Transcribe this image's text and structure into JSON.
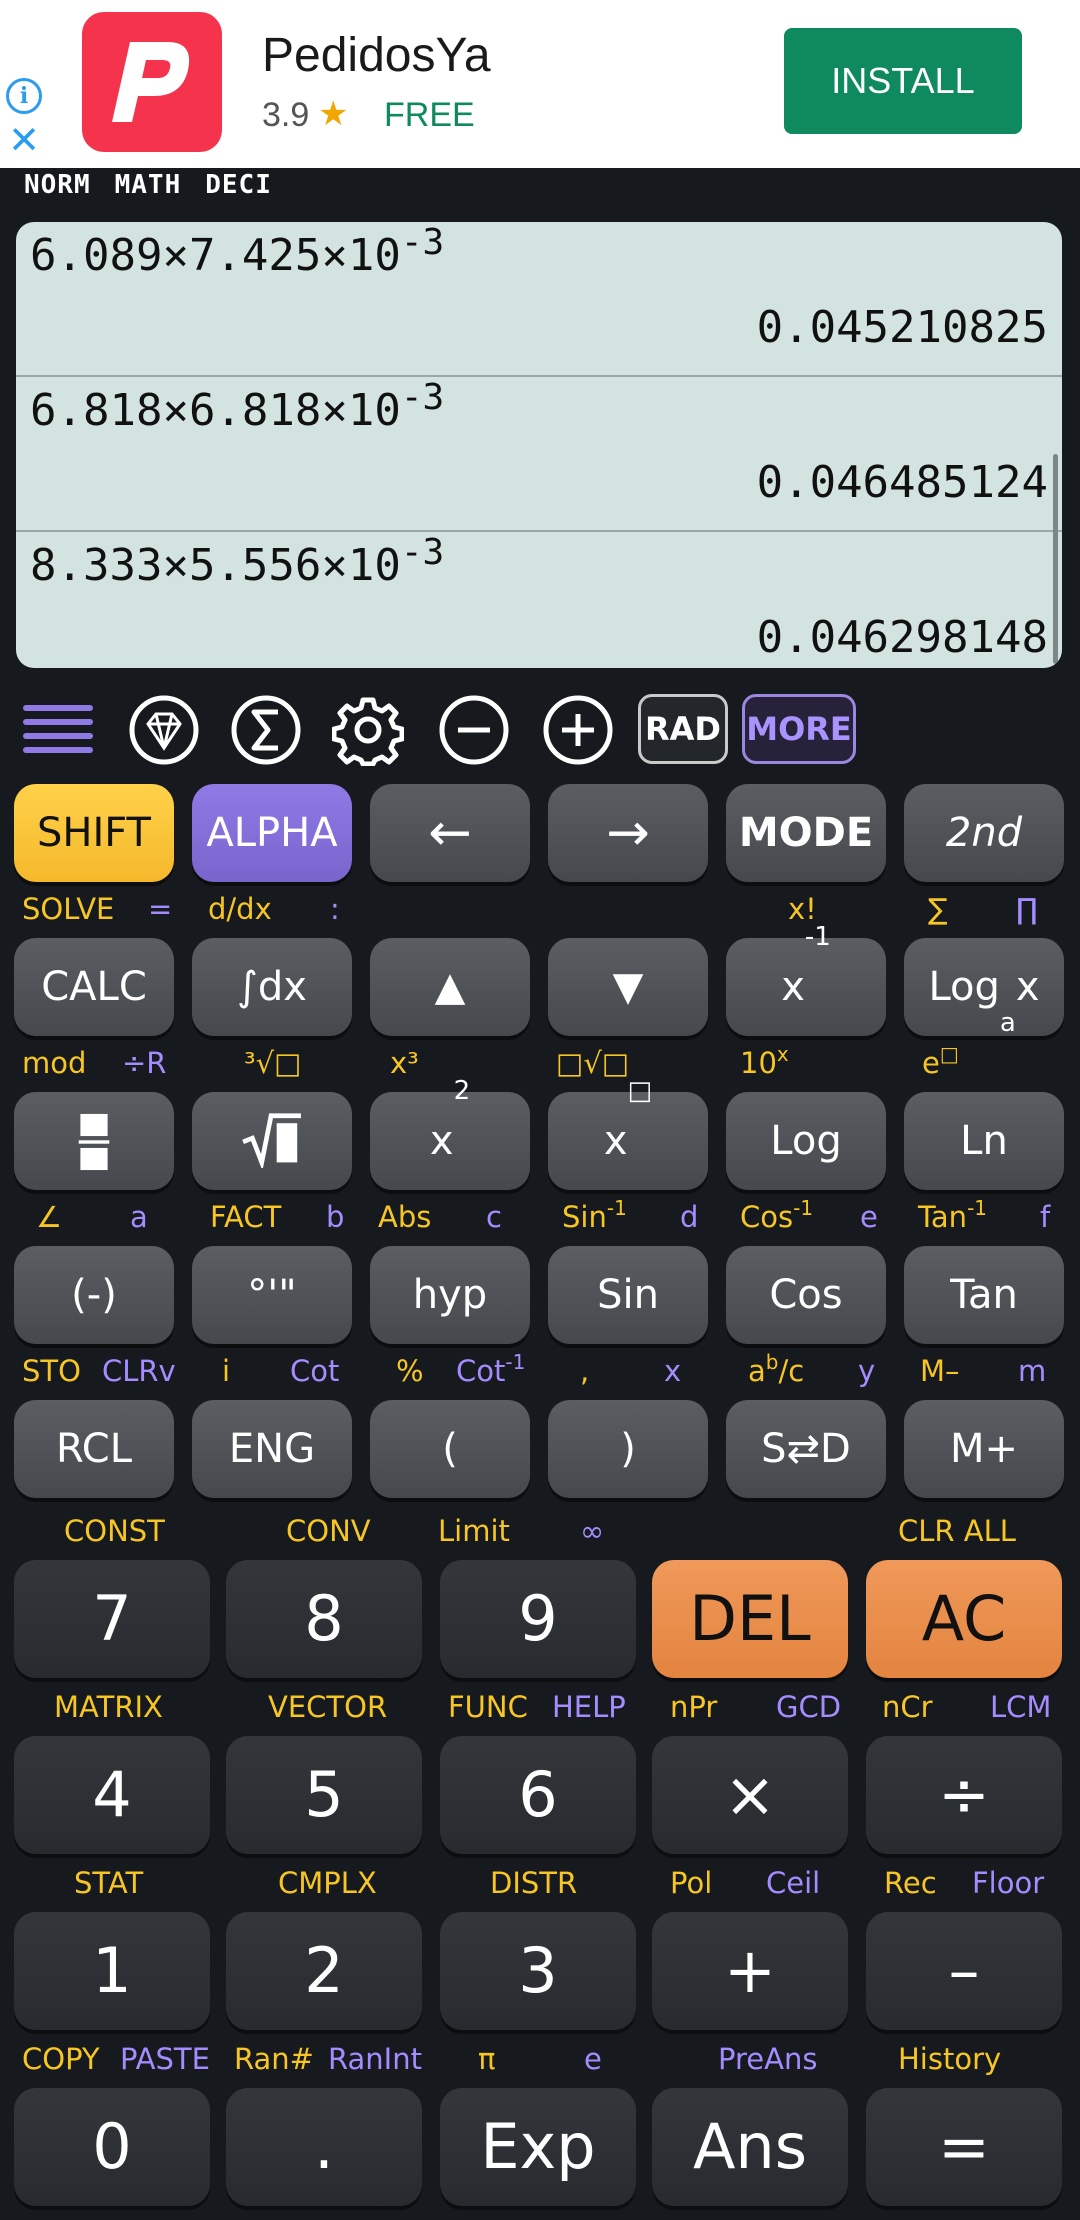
{
  "ad": {
    "app_name": "PedidosYa",
    "rating": "3.9",
    "star": "★",
    "price": "FREE",
    "install_label": "INSTALL",
    "info_glyph": "i",
    "close_glyph": "✕"
  },
  "status": {
    "mode1": "NORM",
    "mode2": "MATH",
    "mode3": "DECI"
  },
  "history": [
    {
      "expr": "6.089×7.425×10",
      "exp": "-3",
      "result": "0.045210825"
    },
    {
      "expr": "6.818×6.818×10",
      "exp": "-3",
      "result": "0.046485124"
    },
    {
      "expr": "8.333×5.556×10",
      "exp": "-3",
      "result": "0.046298148"
    }
  ],
  "toolbar": {
    "rad": "RAD",
    "more": "MORE",
    "icons": [
      "menu-icon",
      "diamond-icon",
      "sigma-icon",
      "gear-icon",
      "minus-icon",
      "plus-icon"
    ]
  },
  "keys": {
    "r1": [
      "SHIFT",
      "ALPHA",
      "←",
      "→",
      "MODE",
      "2nd"
    ],
    "r2": [
      "CALC",
      "∫dx",
      "▲",
      "▼",
      "x",
      "Log"
    ],
    "r2_x_exp": "-1",
    "r2_log_sub": "a",
    "r2_log_x": "x",
    "r3": [
      "",
      "",
      "x",
      "x",
      "Log",
      "Ln"
    ],
    "r3_sq_exp": "2",
    "r3_pow_exp": "□",
    "r4": [
      "(-)",
      "°'\"",
      "hyp",
      "Sin",
      "Cos",
      "Tan"
    ],
    "r5": [
      "RCL",
      "ENG",
      "(",
      ")",
      "S⇄D",
      "M+"
    ],
    "n1": [
      "7",
      "8",
      "9",
      "DEL",
      "AC"
    ],
    "n2": [
      "4",
      "5",
      "6",
      "×",
      "÷"
    ],
    "n3": [
      "1",
      "2",
      "3",
      "+",
      "–"
    ],
    "n4": [
      "0",
      ".",
      "Exp",
      "Ans",
      "="
    ]
  },
  "labels": {
    "l1": {
      "solve": "SOLVE",
      "eq": "=",
      "ddx": "d/dx",
      "colon": ":",
      "fact": "x!",
      "sum": "∑",
      "prod": "∏"
    },
    "l2": {
      "mod": "mod",
      "divr": "÷R",
      "cbrt": "³√□",
      "cube": "x³",
      "nroot": "□√□",
      "ten": "10",
      "ten_exp": "x",
      "e": "e",
      "e_exp": "□"
    },
    "l3": {
      "angle": "∠",
      "a": "a",
      "fact": "FACT",
      "b": "b",
      "abs": "Abs",
      "c": "c",
      "sin": "Sin",
      "sin_exp": "-1",
      "d": "d",
      "cos": "Cos",
      "cos_exp": "-1",
      "e": "e",
      "tan": "Tan",
      "tan_exp": "-1",
      "f": "f"
    },
    "l4": {
      "sto": "STO",
      "clrv": "CLRv",
      "i": "i",
      "cot": "Cot",
      "pct": "%",
      "acot": "Cot",
      "acot_exp": "-1",
      "comma": ",",
      "x": "x",
      "abc": "a",
      "abc_exp": "b",
      "abc_c": "/c",
      "y": "y",
      "mminus": "M–",
      "m": "m"
    },
    "l5": {
      "const": "CONST",
      "conv": "CONV",
      "limit": "Limit",
      "inf": "∞",
      "clrall": "CLR ALL"
    },
    "l6": {
      "matrix": "MATRIX",
      "vector": "VECTOR",
      "func": "FUNC",
      "help": "HELP",
      "npr": "nPr",
      "gcd": "GCD",
      "ncr": "nCr",
      "lcm": "LCM"
    },
    "l7": {
      "stat": "STAT",
      "cmplx": "CMPLX",
      "distr": "DISTR",
      "pol": "Pol",
      "ceil": "Ceil",
      "rec": "Rec",
      "floor": "Floor"
    },
    "l8": {
      "copy": "COPY",
      "paste": "PASTE",
      "ran": "Ran#",
      "ranint": "RanInt",
      "pi": "π",
      "e": "e",
      "preans": "PreAns",
      "history": "History"
    }
  }
}
